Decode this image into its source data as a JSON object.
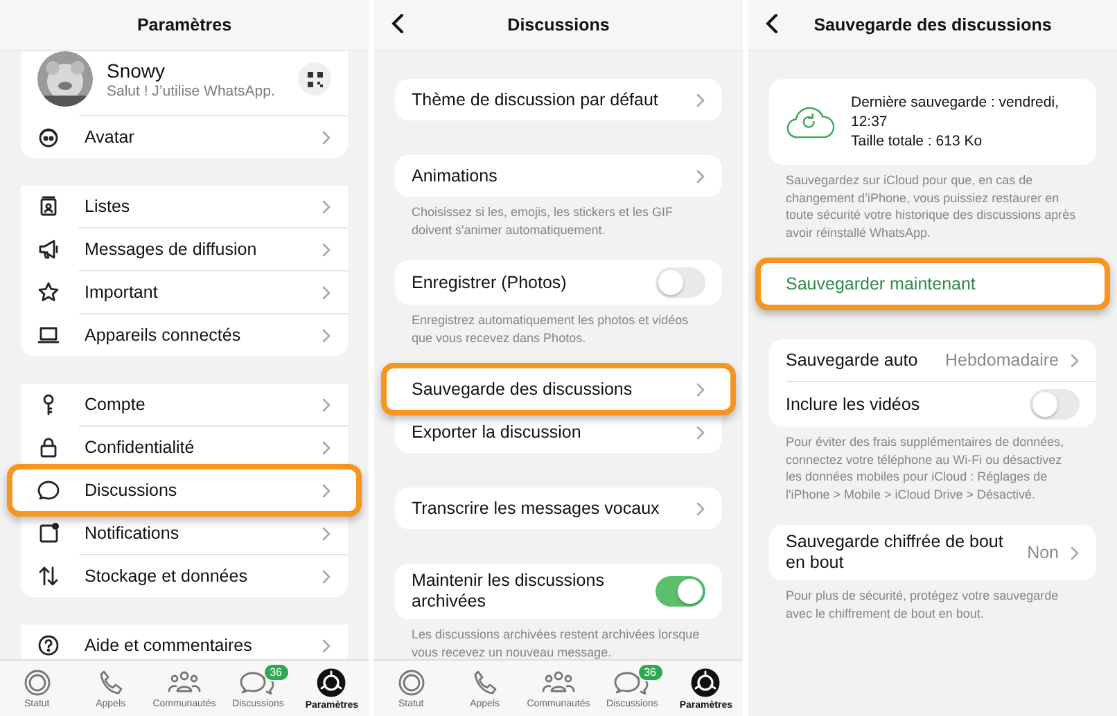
{
  "screens": [
    {
      "title": "Paramètres",
      "back": false,
      "sections": [
        {
          "rows": [
            {
              "kind": "profile",
              "name": "Snowy",
              "status": "Salut ! J’utilise WhatsApp."
            },
            {
              "kind": "nav",
              "label": "Avatar",
              "highlighted": false
            }
          ]
        },
        {
          "rows": [
            {
              "kind": "nav",
              "label": "Listes",
              "highlighted": false
            },
            {
              "kind": "nav",
              "label": "Messages de diffusion",
              "highlighted": false
            },
            {
              "kind": "nav",
              "label": "Important",
              "highlighted": false
            },
            {
              "kind": "nav",
              "label": "Appareils connectés",
              "highlighted": false
            }
          ]
        },
        {
          "rows": [
            {
              "kind": "nav",
              "label": "Compte",
              "highlighted": false
            },
            {
              "kind": "nav",
              "label": "Confidentialité",
              "highlighted": false
            },
            {
              "kind": "nav",
              "label": "Discussions",
              "highlighted": true
            },
            {
              "kind": "nav",
              "label": "Notifications",
              "highlighted": false
            },
            {
              "kind": "nav",
              "label": "Stockage et données",
              "highlighted": false
            }
          ]
        },
        {
          "rows": [
            {
              "kind": "nav",
              "label": "Aide et commentaires",
              "highlighted": false
            }
          ]
        }
      ],
      "tab_bar": [
        {
          "label": "Statut",
          "selected": false
        },
        {
          "label": "Appels",
          "selected": false
        },
        {
          "label": "Communautés",
          "selected": false
        },
        {
          "label": "Discussions",
          "selected": false,
          "badge": "36"
        },
        {
          "label": "Paramètres",
          "selected": true
        }
      ]
    },
    {
      "title": "Discussions",
      "back": true,
      "sections": [
        {
          "rows": [
            {
              "kind": "nav",
              "label": "Thème de discussion par défaut",
              "highlighted": false
            }
          ]
        },
        {
          "rows": [
            {
              "kind": "nav",
              "label": "Animations",
              "highlighted": false
            }
          ],
          "footer": "Choisissez si les, emojis, les stickers et les GIF doivent s'animer automatiquement."
        },
        {
          "rows": [
            {
              "kind": "toggle",
              "label": "Enregistrer (Photos)",
              "on": false
            }
          ],
          "footer": "Enregistrez automatiquement les photos et vidéos que vous recevez dans Photos."
        },
        {
          "rows": [
            {
              "kind": "nav",
              "label": "Sauvegarde des discussions",
              "highlighted": true
            },
            {
              "kind": "nav",
              "label": "Exporter la discussion",
              "highlighted": false
            }
          ]
        },
        {
          "rows": [
            {
              "kind": "nav",
              "label": "Transcrire les messages vocaux",
              "highlighted": false
            }
          ]
        },
        {
          "rows": [
            {
              "kind": "toggle",
              "label": "Maintenir les discussions archivées",
              "on": true
            }
          ],
          "footer": "Les discussions archivées restent archivées lorsque vous recevez un nouveau message."
        }
      ],
      "tab_bar": [
        {
          "label": "Statut",
          "selected": false
        },
        {
          "label": "Appels",
          "selected": false
        },
        {
          "label": "Communautés",
          "selected": false
        },
        {
          "label": "Discussions",
          "selected": false,
          "badge": "36"
        },
        {
          "label": "Paramètres",
          "selected": true
        }
      ]
    },
    {
      "title": "Sauvegarde des discussions",
      "back": true,
      "sections": [
        {
          "rows": [
            {
              "kind": "info",
              "lines": [
                "Dernière sauvegarde : vendredi, 12:37",
                "Taille totale : 613 Ko"
              ]
            }
          ],
          "footer": "Sauvegardez sur iCloud pour que, en cas de changement d’iPhone, vous puissiez restaurer en toute sécurité votre historique des discussions après avoir réinstallé WhatsApp."
        },
        {
          "rows": [
            {
              "kind": "action",
              "label": "Sauvegarder maintenant",
              "highlighted": true
            }
          ]
        },
        {
          "rows": [
            {
              "kind": "nav",
              "label": "Sauvegarde auto",
              "value": "Hebdomadaire",
              "highlighted": false
            },
            {
              "kind": "toggle",
              "label": "Inclure les vidéos",
              "on": false
            }
          ],
          "footer": "Pour éviter des frais supplémentaires de données, connectez votre téléphone au Wi-Fi ou désactivez les données mobiles pour iCloud : Réglages de l'iPhone > Mobile > iCloud Drive > Désactivé."
        },
        {
          "rows": [
            {
              "kind": "nav",
              "label": "Sauvegarde chiffrée de bout en bout",
              "value": "Non",
              "highlighted": false
            }
          ],
          "footer": "Pour plus de sécurité, protégez votre sauvegarde avec le chiffrement de bout en bout."
        }
      ]
    }
  ]
}
